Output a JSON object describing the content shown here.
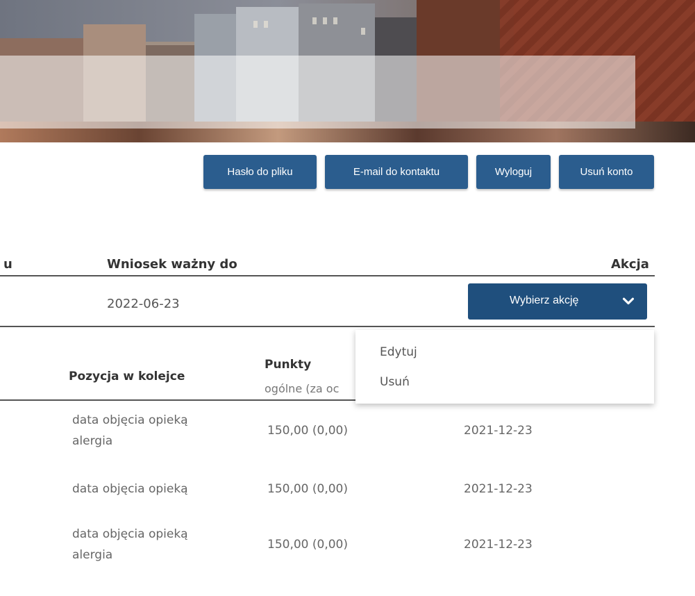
{
  "header_buttons": {
    "file_password": "Hasło do pliku",
    "contact_email": "E-mail do kontaktu",
    "logout": "Wyloguj",
    "delete_account": "Usuń konto"
  },
  "application_table": {
    "col_partial": "u",
    "col_valid_until": "Wniosek ważny do",
    "col_action": "Akcja",
    "row": {
      "valid_until": "2022-06-23",
      "action_select": "Wybierz akcję"
    }
  },
  "action_menu": {
    "items": [
      "Edytuj",
      "Usuń"
    ]
  },
  "queue_table": {
    "col_position": "Pozycja w kolejce",
    "col_points": "Punkty",
    "col_points_sub": "ogólne (za oc",
    "rows": [
      {
        "reason_1": "data objęcia opieką",
        "reason_2": "alergia",
        "points": "150,00 (0,00)",
        "date": "2021-12-23"
      },
      {
        "reason_1": "data objęcia opieką",
        "reason_2": "",
        "points": "150,00 (0,00)",
        "date": "2021-12-23"
      },
      {
        "reason_1": "data objęcia opieką",
        "reason_2": "alergia",
        "points": "150,00 (0,00)",
        "date": "2021-12-23"
      }
    ]
  },
  "colors": {
    "button": "#2b5d8e",
    "select": "#1f4f7d"
  }
}
